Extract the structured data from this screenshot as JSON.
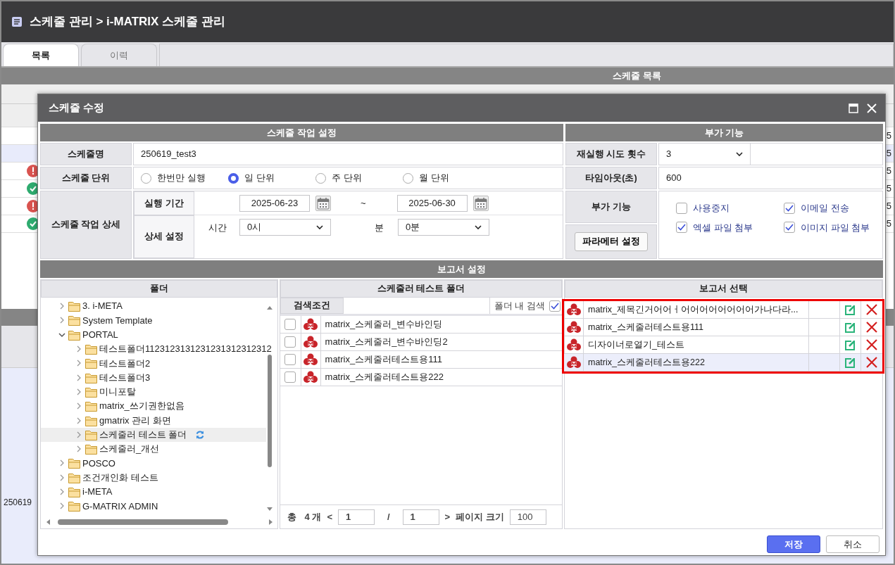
{
  "header": {
    "title": "스케줄 관리 > i-MATRIX 스케줄 관리"
  },
  "tabs": [
    {
      "label": "목록",
      "selected": true
    },
    {
      "label": "이력",
      "selected": false
    }
  ],
  "list_section": {
    "title": "스케줄 목록",
    "rows": [
      {
        "kind": "plain",
        "selected": false,
        "cell": "5"
      },
      {
        "kind": "plain",
        "selected": true,
        "cell": "5"
      },
      {
        "kind": "error",
        "selected": false,
        "cell": "5"
      },
      {
        "kind": "success",
        "selected": false,
        "cell": "5"
      },
      {
        "kind": "error",
        "selected": false,
        "cell": "5"
      },
      {
        "kind": "success",
        "selected": false,
        "cell": "5"
      }
    ],
    "lower_cell": "250619"
  },
  "dialog": {
    "title": "스케줄 수정",
    "job_settings": {
      "title": "스케줄 작업 설정",
      "name_label": "스케줄명",
      "name_value": "250619_test3",
      "unit_label": "스케줄 단위",
      "units": [
        {
          "label": "한번만 실행",
          "selected": false
        },
        {
          "label": "일 단위",
          "selected": true
        },
        {
          "label": "주 단위",
          "selected": false
        },
        {
          "label": "월 단위",
          "selected": false
        }
      ],
      "detail_label": "스케줄 작업 상세",
      "period_label": "실행 기간",
      "start_date": "2025-06-23",
      "separator": "~",
      "end_date": "2025-06-30",
      "detail_settings_label": "상세 설정",
      "hour_label": "시간",
      "hour_value": "0시",
      "minute_label": "분",
      "minute_value": "0분"
    },
    "extra": {
      "title": "부가 기능",
      "retry_label": "재실행 시도 횟수",
      "retry_value": "3",
      "timeout_label": "타임아웃(초)",
      "timeout_value": "600",
      "features_label": "부가 기능",
      "param_button": "파라메터 설정",
      "options": [
        {
          "label": "사용중지",
          "checked": false
        },
        {
          "label": "이메일 전송",
          "checked": true
        },
        {
          "label": "엑셀 파일 첨부",
          "checked": true
        },
        {
          "label": "이미지 파일 첨부",
          "checked": true
        }
      ]
    },
    "report_settings": {
      "title": "보고서 설정",
      "folder_panel": {
        "title": "폴더",
        "tree": [
          {
            "label": "3. i-META",
            "expanded": false,
            "selected": false
          },
          {
            "label": "System Template",
            "expanded": false,
            "selected": false
          },
          {
            "label": "PORTAL",
            "expanded": true,
            "selected": false,
            "children": [
              {
                "label": "테스트폴더1123123131231231312312312",
                "expanded": false,
                "selected": false
              },
              {
                "label": "테스트폴더2",
                "expanded": false,
                "selected": false
              },
              {
                "label": "테스트폴더3",
                "expanded": false,
                "selected": false
              },
              {
                "label": "미니포탈",
                "expanded": false,
                "selected": false
              },
              {
                "label": "matrix_쓰기권한없음",
                "expanded": false,
                "selected": false
              },
              {
                "label": "gmatrix 관리 화면",
                "expanded": false,
                "selected": false
              },
              {
                "label": "스케줄러 테스트 폴더",
                "expanded": false,
                "selected": true
              },
              {
                "label": "스케줄러_개선",
                "expanded": false,
                "selected": false
              }
            ]
          },
          {
            "label": "POSCO",
            "expanded": false,
            "selected": false
          },
          {
            "label": "조건개인화 테스트",
            "expanded": false,
            "selected": false
          },
          {
            "label": "i-META",
            "expanded": false,
            "selected": false
          },
          {
            "label": "G-MATRIX ADMIN",
            "expanded": false,
            "selected": false
          }
        ]
      },
      "report_panel": {
        "title": "스케줄러 테스트 폴더",
        "search_label": "검색조건",
        "folder_search_label": "폴더 내 검색",
        "folder_search_checked": true,
        "reports": [
          {
            "name": "matrix_스케줄러_변수바인딩",
            "checked": false
          },
          {
            "name": "matrix_스케줄러_변수바인딩2",
            "checked": false
          },
          {
            "name": "matrix_스케줄러테스트용111",
            "checked": false
          },
          {
            "name": "matrix_스케줄러테스트용222",
            "checked": false
          }
        ],
        "pager": {
          "total_label": "총",
          "count": "4 개",
          "prev": "<",
          "page": "1",
          "slash": "/",
          "pages": "1",
          "next": ">",
          "size_label": "페이지 크기",
          "size": "100"
        }
      },
      "selected_panel": {
        "title": "보고서 선택",
        "reports": [
          {
            "name": "matrix_제목긴거어어ㅓ어어어어어어어어가나다라...",
            "selected": false
          },
          {
            "name": "matrix_스케줄러테스트용111",
            "selected": false
          },
          {
            "name": "디자이너로열기_테스트",
            "selected": false
          },
          {
            "name": "matrix_스케줄러테스트용222",
            "selected": true
          }
        ]
      }
    },
    "buttons": [
      {
        "label": "저장",
        "kind": "primary"
      },
      {
        "label": "취소",
        "kind": "secondary"
      }
    ]
  }
}
